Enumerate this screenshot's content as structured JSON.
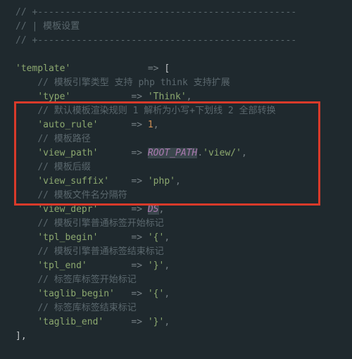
{
  "comment_block": {
    "line1": "// +-----------------------------------------------",
    "line2": "// | 模板设置",
    "line3": "// +-----------------------------------------------"
  },
  "template": {
    "key": "'template'",
    "arrow": "=>",
    "open": "[",
    "close": "],",
    "items": [
      {
        "comment": "// 模板引擎类型 支持 php think 支持扩展",
        "key": "'type'",
        "arrow": "=>",
        "value": "'Think'",
        "comma": ","
      },
      {
        "comment": "// 默认模板渲染规则 1 解析为小写+下划线 2 全部转换",
        "key": "'auto_rule'",
        "arrow": "=>",
        "value": "1",
        "comma": ",",
        "value_type": "number"
      },
      {
        "comment": "// 模板路径",
        "key": "'view_path'",
        "arrow": "=>",
        "const": "ROOT_PATH",
        "concat": ".",
        "value": "'view/'",
        "comma": ","
      },
      {
        "comment": "// 模板后缀",
        "key": "'view_suffix'",
        "arrow": "=>",
        "value": "'php'",
        "comma": ","
      },
      {
        "comment": "// 模板文件名分隔符",
        "key": "'view_depr'",
        "arrow": "=>",
        "const": "DS",
        "comma": ","
      },
      {
        "comment": "// 模板引擎普通标签开始标记",
        "key": "'tpl_begin'",
        "arrow": "=>",
        "value": "'{'",
        "comma": ","
      },
      {
        "comment": "// 模板引擎普通标签结束标记",
        "key": "'tpl_end'",
        "arrow": "=>",
        "value": "'}'",
        "comma": ","
      },
      {
        "comment": "// 标签库标签开始标记",
        "key": "'taglib_begin'",
        "arrow": "=>",
        "value": "'{'",
        "comma": ","
      },
      {
        "comment": "// 标签库标签结束标记",
        "key": "'taglib_end'",
        "arrow": "=>",
        "value": "'}'",
        "comma": ","
      }
    ]
  }
}
